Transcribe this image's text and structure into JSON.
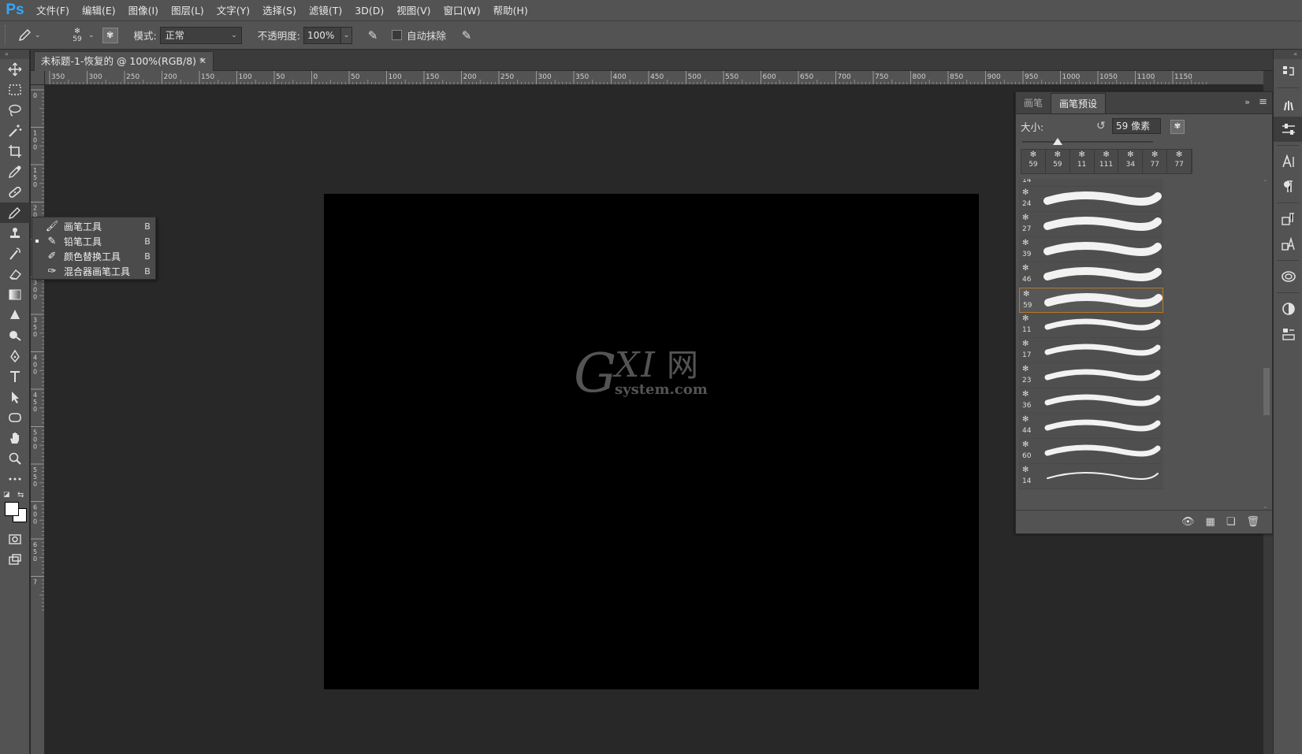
{
  "app": {
    "logo": "Ps"
  },
  "menu": [
    "文件(F)",
    "编辑(E)",
    "图像(I)",
    "图层(L)",
    "文字(Y)",
    "选择(S)",
    "滤镜(T)",
    "3D(D)",
    "视图(V)",
    "窗口(W)",
    "帮助(H)"
  ],
  "options": {
    "brush_size": "59",
    "mode_label": "模式:",
    "mode_value": "正常",
    "opacity_label": "不透明度:",
    "opacity_value": "100%",
    "auto_erase_label": "自动抹除"
  },
  "document": {
    "tab_title": "未标题-1-恢复的 @ 100%(RGB/8) *"
  },
  "ruler": {
    "h_labels": [
      "350",
      "300",
      "250",
      "200",
      "150",
      "100",
      "50",
      "0",
      "50",
      "100",
      "150",
      "200",
      "250",
      "300",
      "350",
      "400",
      "450",
      "500",
      "550",
      "600",
      "650",
      "700",
      "750",
      "800",
      "850",
      "900",
      "950",
      "1000",
      "1050",
      "1100",
      "1150"
    ],
    "v_labels": [
      "0",
      "1 0 0",
      "1 5 0",
      "2 0 0",
      "2 5 0",
      "3 0 0",
      "3 5 0",
      "4 0 0",
      "4 5 0",
      "5 0 0",
      "5 5 0",
      "6 0 0",
      "6 5 0",
      "7"
    ]
  },
  "flyout": {
    "items": [
      {
        "label": "画笔工具",
        "key": "B",
        "icon": "brush-icon",
        "current": false
      },
      {
        "label": "铅笔工具",
        "key": "B",
        "icon": "pencil-icon",
        "current": true
      },
      {
        "label": "颜色替换工具",
        "key": "B",
        "icon": "color-replacement-icon",
        "current": false
      },
      {
        "label": "混合器画笔工具",
        "key": "B",
        "icon": "mixer-brush-icon",
        "current": false
      }
    ]
  },
  "watermark": {
    "g": "G",
    "xi": "XI",
    "net": "网",
    "url": "system.com"
  },
  "brush_panel": {
    "tab_brush": "画笔",
    "tab_presets": "画笔预设",
    "size_label": "大小:",
    "size_value": "59 像素",
    "slider_fraction": 0.27,
    "recent": [
      "59",
      "59",
      "11",
      "111",
      "34",
      "77",
      "77"
    ],
    "partial_top": "14",
    "presets": [
      {
        "size": "24",
        "selected": false,
        "stroke": "thick"
      },
      {
        "size": "27",
        "selected": false,
        "stroke": "thick"
      },
      {
        "size": "39",
        "selected": false,
        "stroke": "thick"
      },
      {
        "size": "46",
        "selected": false,
        "stroke": "thick"
      },
      {
        "size": "59",
        "selected": true,
        "stroke": "thick"
      },
      {
        "size": "11",
        "selected": false,
        "stroke": "medium"
      },
      {
        "size": "17",
        "selected": false,
        "stroke": "medium"
      },
      {
        "size": "23",
        "selected": false,
        "stroke": "medium"
      },
      {
        "size": "36",
        "selected": false,
        "stroke": "medium"
      },
      {
        "size": "44",
        "selected": false,
        "stroke": "medium"
      },
      {
        "size": "60",
        "selected": false,
        "stroke": "medium"
      },
      {
        "size": "14",
        "selected": false,
        "stroke": "thin"
      }
    ]
  },
  "colors": {
    "panel_selected_border": "#b87a2a",
    "ps_blue": "#31a8ff",
    "foreground": "#ffffff",
    "background": "#ffffff"
  }
}
